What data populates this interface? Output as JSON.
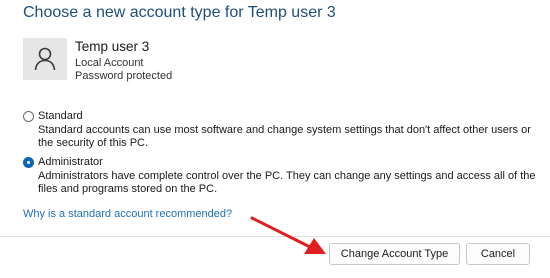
{
  "header": {
    "title": "Choose a new account type for Temp user 3"
  },
  "user": {
    "avatar_icon": "person-icon",
    "name": "Temp user 3",
    "account_kind": "Local Account",
    "security": "Password protected"
  },
  "options": [
    {
      "label": "Standard",
      "selected": false,
      "description": "Standard accounts can use most software and change system settings that don't affect other users or the security of this PC."
    },
    {
      "label": "Administrator",
      "selected": true,
      "description": "Administrators have complete control over the PC. They can change any settings and access all of the files and programs stored on the PC."
    }
  ],
  "help_link": "Why is a standard account recommended?",
  "buttons": {
    "change": "Change Account Type",
    "cancel": "Cancel"
  },
  "annotation": {
    "arrow_icon": "red-arrow-icon",
    "color": "#e02020"
  },
  "colors": {
    "title": "#1f4e79",
    "link": "#1e6fb8",
    "radio_selected": "#0a64b4"
  }
}
